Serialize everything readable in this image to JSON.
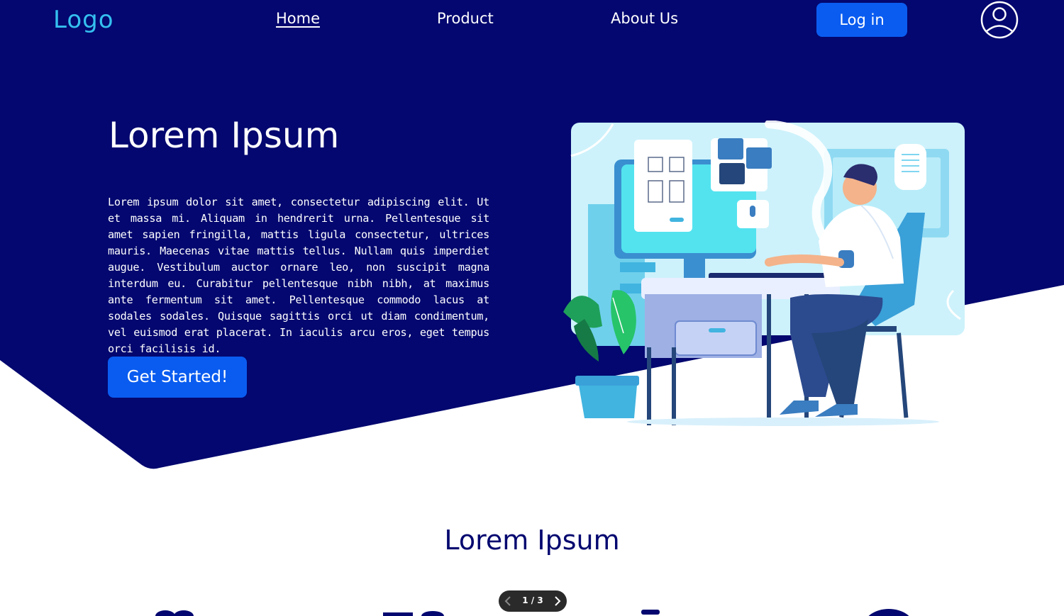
{
  "nav": {
    "logo": "Logo",
    "links": [
      {
        "label": "Home",
        "active": true
      },
      {
        "label": "Product",
        "active": false
      },
      {
        "label": "About Us",
        "active": false
      }
    ],
    "login_label": "Log in"
  },
  "hero": {
    "title": "Lorem Ipsum",
    "body": "Lorem ipsum dolor sit amet, consectetur adipiscing elit. Ut et massa mi. Aliquam in hendrerit urna. Pellentesque sit amet sapien fringilla, mattis ligula consectetur, ultrices mauris. Maecenas vitae mattis tellus. Nullam quis imperdiet augue. Vestibulum auctor ornare leo, non suscipit magna interdum eu. Curabitur pellentesque nibh nibh, at maximus ante fermentum sit amet. Pellentesque commodo lacus at sodales sodales. Quisque sagittis orci ut diam condimentum, vel euismod erat placerat. In iaculis arcu eros, eget tempus orci facilisis id.",
    "cta_label": "Get Started!"
  },
  "section": {
    "title": "Lorem Ipsum"
  },
  "pager": {
    "label": "1 / 3"
  },
  "colors": {
    "navy": "#03076f",
    "accent_blue": "#0a5cf0",
    "logo_cyan": "#35c0f0"
  },
  "icons": [
    "user-avatar-icon",
    "chevron-left-icon",
    "chevron-right-icon"
  ]
}
